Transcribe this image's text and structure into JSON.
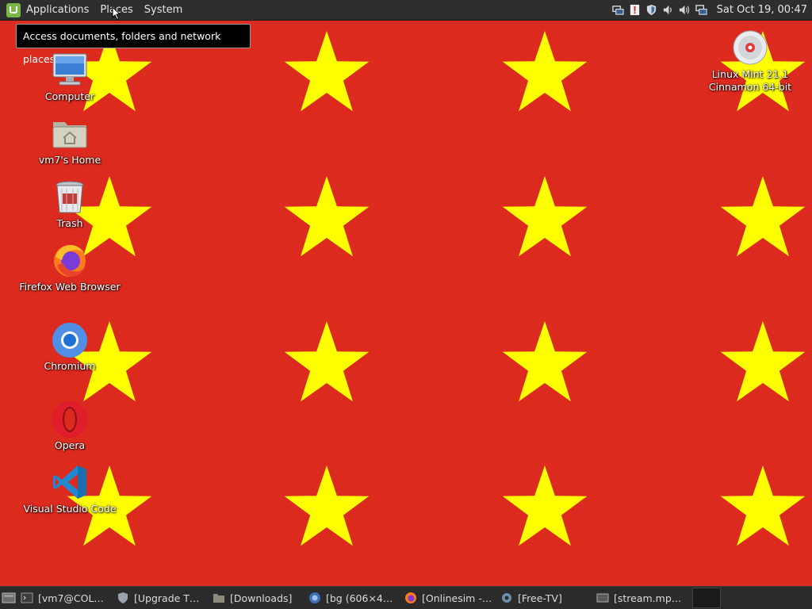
{
  "top_panel": {
    "menus": [
      "Applications",
      "Places",
      "System"
    ],
    "clock": "Sat Oct 19, 00:47",
    "tray_icons": [
      "network-icon",
      "update-manager-icon",
      "shield-icon",
      "volume-icon",
      "sound-icon",
      "network-wired-icon"
    ]
  },
  "tooltip": "Access documents, folders and network places",
  "desktop": {
    "icons": [
      {
        "label": "Computer",
        "icon": "computer-icon"
      },
      {
        "label": "vm7's Home",
        "icon": "home-folder-icon"
      },
      {
        "label": "Trash",
        "icon": "trash-icon"
      },
      {
        "label": "Firefox Web Browser",
        "icon": "firefox-icon"
      },
      {
        "label": "Chromium",
        "icon": "chromium-icon"
      },
      {
        "label": "Opera",
        "icon": "opera-icon"
      },
      {
        "label": "Visual Studio Code",
        "icon": "vscode-icon"
      }
    ],
    "disc": {
      "line1": "Linux Mint 21.1",
      "line2": "Cinnamon 64-bit",
      "icon": "optical-disc-icon"
    }
  },
  "taskbar": {
    "items": [
      {
        "label": "[vm7@COL…",
        "icon": "terminal-icon"
      },
      {
        "label": "[Upgrade T…",
        "icon": "shield-icon"
      },
      {
        "label": "[Downloads]",
        "icon": "folder-icon"
      },
      {
        "label": "[bg (606×4…",
        "icon": "image-viewer-icon"
      },
      {
        "label": "[Onlinesim -…",
        "icon": "firefox-icon"
      },
      {
        "label": "[Free-TV]",
        "icon": "settings-icon"
      },
      {
        "label": "[stream.mp…",
        "icon": "video-icon"
      }
    ]
  },
  "colors": {
    "wallpaper": "#dc2a1f",
    "star": "#ffff00",
    "panel": "#2e2e2e"
  }
}
